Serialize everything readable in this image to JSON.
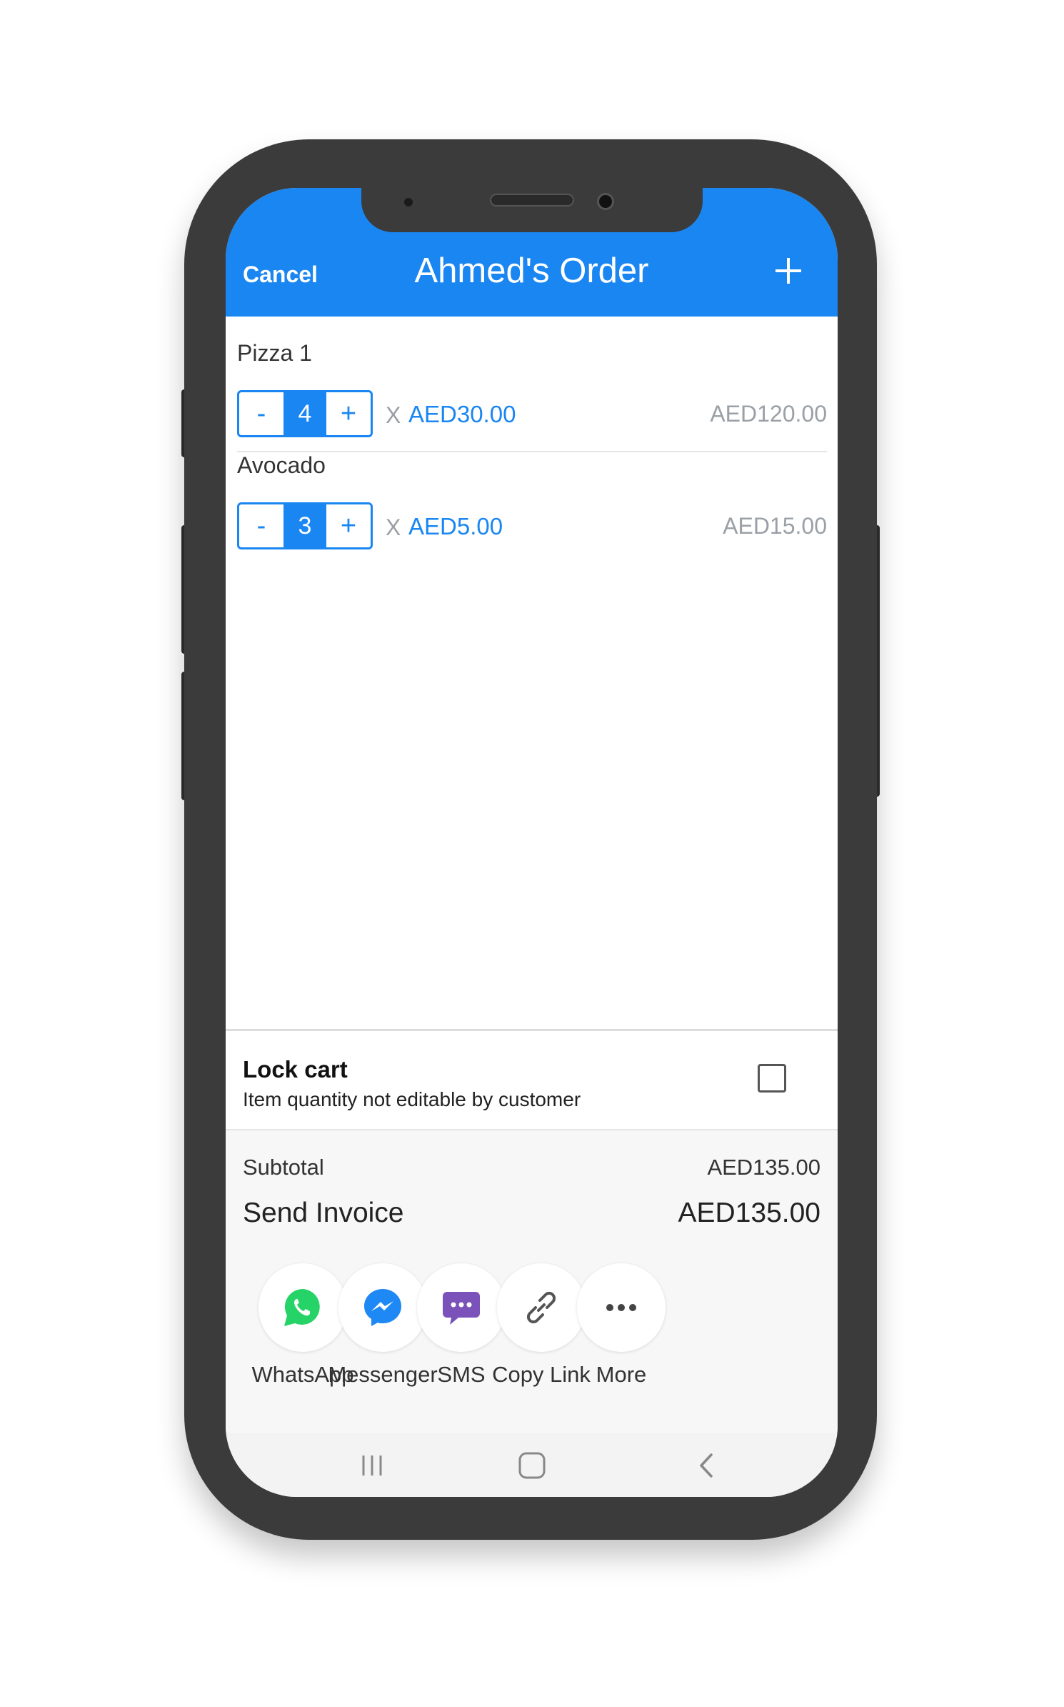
{
  "header": {
    "cancel_label": "Cancel",
    "title": "Ahmed's Order",
    "accent_color": "#1a86f2"
  },
  "items": [
    {
      "name": "Pizza 1",
      "quantity": "4",
      "minus_label": "-",
      "plus_label": "+",
      "times": "X",
      "unit_price": "AED30.00",
      "line_total": "AED120.00"
    },
    {
      "name": "Avocado",
      "quantity": "3",
      "minus_label": "-",
      "plus_label": "+",
      "times": "X",
      "unit_price": "AED5.00",
      "line_total": "AED15.00"
    }
  ],
  "lock_cart": {
    "title": "Lock cart",
    "subtitle": "Item quantity not editable by customer",
    "checked": false
  },
  "summary": {
    "subtotal_label": "Subtotal",
    "subtotal_value": "AED135.00",
    "invoice_label": "Send Invoice",
    "invoice_value": "AED135.00"
  },
  "share": [
    {
      "label": "WhatsApp",
      "icon": "whatsapp-icon",
      "color": "#25d366"
    },
    {
      "label": "Messenger",
      "icon": "messenger-icon",
      "color": "#1e88f5"
    },
    {
      "label": "SMS",
      "icon": "sms-icon",
      "color": "#7b52b9"
    },
    {
      "label": "Copy Link",
      "icon": "link-icon",
      "color": "#555555"
    },
    {
      "label": "More",
      "icon": "more-icon",
      "color": "#444444"
    }
  ],
  "nav": {
    "recents_icon": "recents-icon",
    "home_icon": "home-icon",
    "back_icon": "back-icon"
  }
}
